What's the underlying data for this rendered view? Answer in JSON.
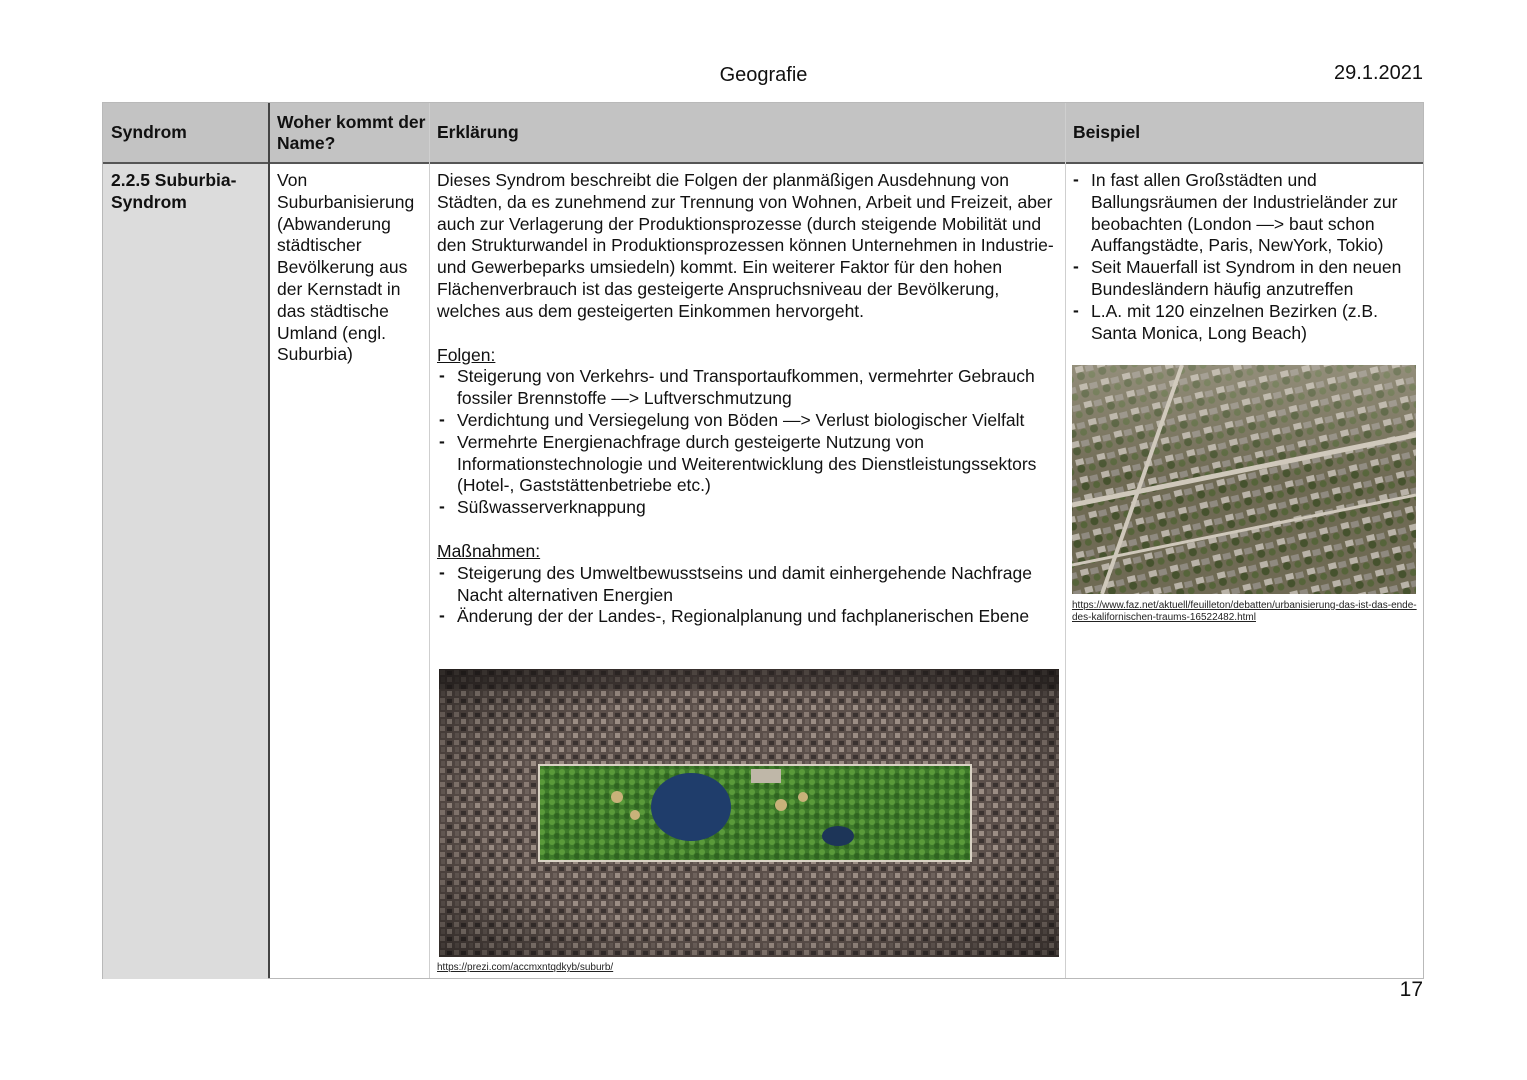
{
  "page": {
    "subject": "Geografie",
    "date": "29.1.2021",
    "number": "17"
  },
  "table": {
    "headers": [
      "Syndrom",
      "Woher kommt der Name?",
      "Erklärung",
      "Beispiel"
    ],
    "row": {
      "syndrom": "2.2.5 Suburbia-Syndrom",
      "herkunft": "Von Suburbanisierung (Abwanderung städtischer Bevölkerung aus der Kernstadt in das städtische Umland (engl. Suburbia)",
      "erklaerung": {
        "intro": "Dieses Syndrom beschreibt die Folgen der planmäßigen Ausdehnung von Städten, da es zunehmend zur Trennung von Wohnen, Arbeit und Freizeit, aber auch zur Verlagerung der Produktionsprozesse (durch steigende Mobilität und den Strukturwandel in Produktionsprozessen können Unternehmen in Industrie- und Gewerbeparks umsiedeln) kommt. Ein weiterer Faktor für den hohen Flächenverbrauch  ist das gesteigerte Anspruchsniveau der Bevölkerung, welches aus dem gesteigerten Einkommen hervorgeht.",
        "folgen_heading": "Folgen:",
        "folgen": [
          "Steigerung von Verkehrs- und Transportaufkommen, vermehrter Gebrauch fossiler Brennstoffe —> Luftverschmutzung",
          "Verdichtung und Versiegelung von Böden —> Verlust biologischer Vielfalt",
          "Vermehrte Energienachfrage durch gesteigerte Nutzung von Informationstechnologie und Weiterentwicklung des Dienstleistungssektors (Hotel-, Gaststättenbetriebe etc.)",
          "Süßwasserverknappung"
        ],
        "massnahmen_heading": "Maßnahmen:",
        "massnahmen": [
          "Steigerung des Umweltbewusstseins und damit einhergehende Nachfrage Nacht alternativen Energien",
          "Änderung der der Landes-, Regionalplanung und fachplanerischen Ebene"
        ],
        "image_caption": "https://prezi.com/accmxntqdkyb/suburb/"
      },
      "beispiel": {
        "items": [
          "In fast allen Großstädten und Ballungsräumen der Industrieländer zur beobachten (London —> baut schon Auffangstädte, Paris, NewYork, Tokio)",
          "Seit Mauerfall ist Syndrom in den neuen Bundesländern häufig anzutreffen",
          "L.A. mit 120 einzelnen Bezirken (z.B. Santa Monica, Long Beach)"
        ],
        "image_caption": "https://www.faz.net/aktuell/feuilleton/debatten/urbanisierung-das-ist-das-ende-des-kalifornischen-traums-16522482.html"
      }
    }
  }
}
